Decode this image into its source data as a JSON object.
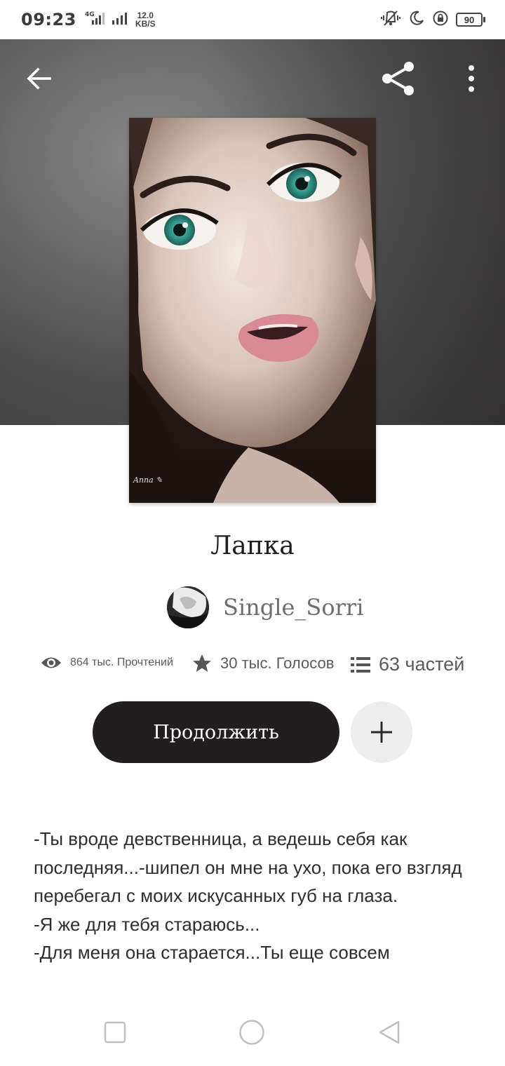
{
  "status_bar": {
    "time": "09:23",
    "network_type": "4G",
    "net_speed_value": "12.0",
    "net_speed_unit": "KB/S",
    "battery": "90"
  },
  "header": {
    "back_icon": "arrow-left-icon",
    "share_icon": "share-icon",
    "more_icon": "more-vertical-icon"
  },
  "story": {
    "title": "Лапка",
    "author": "Single_Sorri",
    "reads": "864 тыс. Прочтений",
    "votes": "30 тыс. Голосов",
    "parts": "63 частей"
  },
  "actions": {
    "continue_label": "Продолжить",
    "add_icon": "plus-icon"
  },
  "description": [
    "-Ты вроде девственница, а ведешь себя как последняя...-шипел он мне на ухо, пока его взгляд перебегал с моих искусанных губ на глаза.",
    "-Я же для тебя стараюсь...",
    "-Для меня она старается...Ты еще совсем"
  ],
  "colors": {
    "continue_bg": "#221e1f",
    "add_bg": "#eeedee",
    "hero_bg": "#5a5a5a"
  }
}
